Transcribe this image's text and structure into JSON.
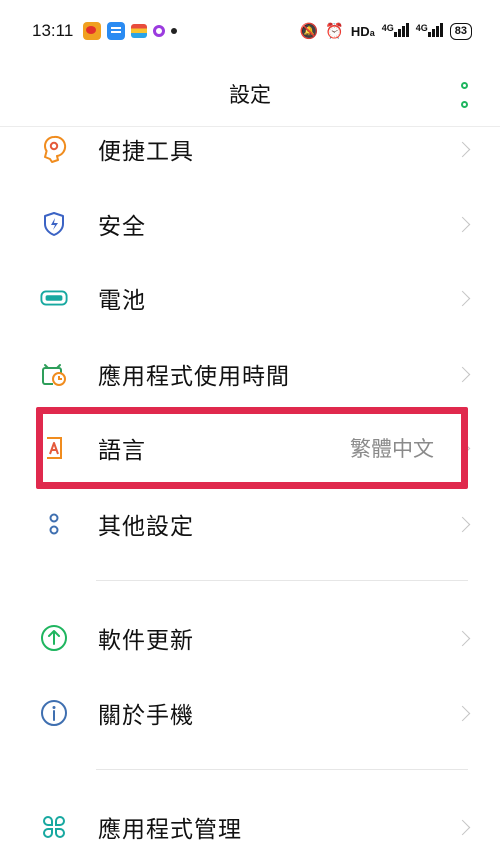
{
  "status_bar": {
    "time": "13:11",
    "network_label": "HD",
    "network_sub": "a",
    "signal1_label": "4G",
    "signal2_label": "4G",
    "battery": "83"
  },
  "header": {
    "title": "設定"
  },
  "settings": {
    "items": [
      {
        "label": "便捷工具",
        "icon": "hand-pointer-icon",
        "color": "#f08c1e"
      },
      {
        "label": "安全",
        "icon": "shield-bolt-icon",
        "color": "#3b63c4"
      },
      {
        "label": "電池",
        "icon": "battery-icon",
        "color": "#17a8a0"
      },
      {
        "label": "應用程式使用時間",
        "icon": "app-usage-clock-icon",
        "color": "#2e9e5a"
      },
      {
        "label": "語言",
        "value": "繁體中文",
        "icon": "language-icon",
        "color": "#e45a3c"
      },
      {
        "label": "其他設定",
        "icon": "more-settings-icon",
        "color": "#3f6fb0"
      },
      {
        "label": "軟件更新",
        "icon": "update-arrow-icon",
        "color": "#1fb55f"
      },
      {
        "label": "關於手機",
        "icon": "info-icon",
        "color": "#3f6fb0"
      },
      {
        "label": "應用程式管理",
        "icon": "app-grid-icon",
        "color": "#17a8a0"
      }
    ]
  },
  "highlight_color": "#e0294d"
}
